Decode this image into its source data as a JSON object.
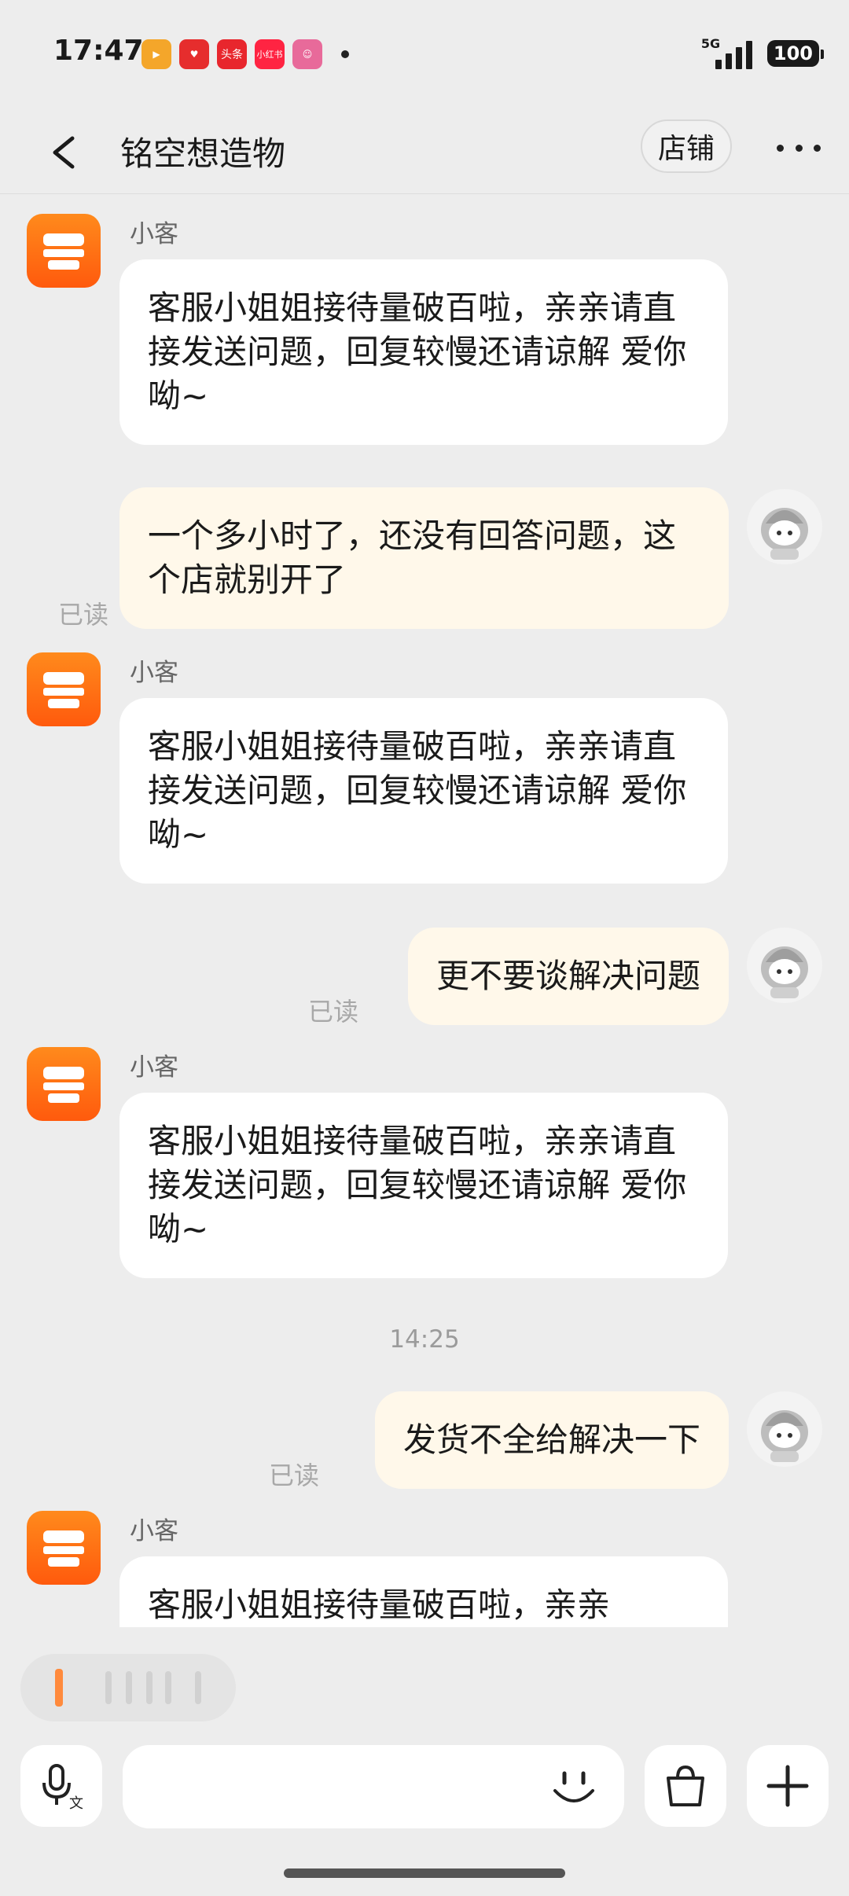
{
  "status_bar": {
    "time": "17:47",
    "network": "5G",
    "battery": "100",
    "notification_icons": [
      {
        "name": "video-app-icon",
        "label": "",
        "color": "#f4a62a"
      },
      {
        "name": "pinduoduo-icon",
        "label": "",
        "color": "#e62d2d"
      },
      {
        "name": "toutiao-icon",
        "label": "头条",
        "color": "#e8262d"
      },
      {
        "name": "xiaohongshu-icon",
        "label": "小红书",
        "color": "#ff2442"
      },
      {
        "name": "game-app-icon",
        "label": "",
        "color": "#e86a9a"
      }
    ]
  },
  "header": {
    "shop_name": "铭空想造物",
    "store_button": "店铺"
  },
  "messages": [
    {
      "type": "in",
      "sender": "小客",
      "text": "客服小姐姐接待量破百啦，亲亲请直接发送问题，回复较慢还请谅解 爱你呦~"
    },
    {
      "type": "out",
      "text": "一个多小时了，还没有回答问题，这个店就别开了",
      "status": "已读"
    },
    {
      "type": "in",
      "sender": "小客",
      "text": "客服小姐姐接待量破百啦，亲亲请直接发送问题，回复较慢还请谅解 爱你呦~"
    },
    {
      "type": "out",
      "text": "更不要谈解决问题",
      "status": "已读"
    },
    {
      "type": "in",
      "sender": "小客",
      "text": "客服小姐姐接待量破百啦，亲亲请直接发送问题，回复较慢还请谅解 爱你呦~"
    },
    {
      "type": "time",
      "text": "14:25"
    },
    {
      "type": "out",
      "text": "发货不全给解决一下",
      "status": "已读"
    },
    {
      "type": "in",
      "sender": "小客",
      "text": "客服小姐姐接待量破百啦，亲亲"
    }
  ],
  "colors": {
    "accent": "#ff6a10",
    "outgoing_bubble": "#fff8ea",
    "incoming_bubble": "#ffffff",
    "background": "#ededed"
  }
}
